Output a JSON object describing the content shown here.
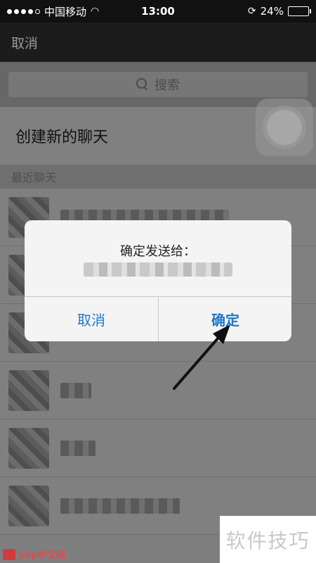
{
  "status_bar": {
    "carrier": "中国移动",
    "time": "13:00",
    "battery": "24%",
    "battery_level": 0.24,
    "signal_bars": 4
  },
  "nav": {
    "cancel_label": "取消"
  },
  "search": {
    "placeholder": "搜索"
  },
  "create_chat": {
    "label": "创建新的聊天"
  },
  "recent": {
    "header": "最近聊天"
  },
  "dialog": {
    "title": "确定发送给：",
    "cancel_label": "取消",
    "confirm_label": "确定"
  },
  "watermarks": {
    "bottom_left": "php中文网",
    "bottom_right": "软件技巧"
  },
  "icons": {
    "wifi": "wifi-icon",
    "rotation_lock": "rotation-lock-icon",
    "battery": "battery-icon",
    "search": "search-icon",
    "chevron": "chevron-right-icon",
    "arrow": "pointer-arrow-icon"
  },
  "colors": {
    "accent": "#1f78c8",
    "dialog_bg": "#f4f4f4"
  }
}
